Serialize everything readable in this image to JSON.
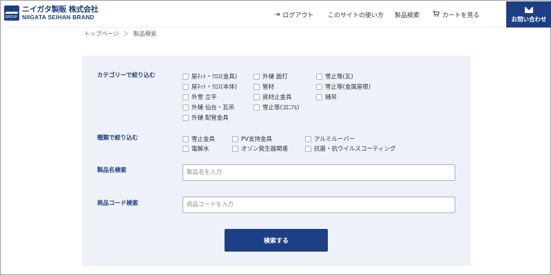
{
  "brand": {
    "mark_text": "GROUP",
    "name_jp": "ニイガタ製販 株式会社",
    "name_en": "NIIGATA SEIHAN BRAND"
  },
  "nav": {
    "logout": "ログアウト",
    "howto": "このサイトの使い方",
    "product_search": "製品検索",
    "cart": "カートを見る",
    "contact": "お問い合わせ"
  },
  "breadcrumb": {
    "home": "トップページ",
    "separator": "＞",
    "current": "製品検索"
  },
  "filters": {
    "category_label": "カテゴリーで絞り込む",
    "categories": [
      "屋ﾈｯﾄ・ｸﾛｽ(金具)",
      "外樋 面打",
      "雪止等(瓦)",
      "屋ﾈｯﾄ・ｸﾛｽ(本体)",
      "管材",
      "雪止等(金属屋根)",
      "外雪 立平",
      "資材止金具",
      "樋吊",
      "外樋 仙台・瓦吊",
      "雪止等(ｺﾛﾆｱﾙ)",
      "外樋 配管金具"
    ],
    "kind_label": "種類で絞り込む",
    "kinds": [
      "雪止金具",
      "PV支持金具",
      "アルミルーバー",
      "電解水",
      "オゾン発生器関連",
      "抗菌・抗ウイルスコーティング"
    ],
    "name_label": "製品名検索",
    "name_placeholder": "製品名を入力",
    "code_label": "商品コード検索",
    "code_placeholder": "商品コードを入力",
    "submit": "検索する"
  },
  "colors": {
    "brand_navy": "#1d3f86",
    "panel_bg": "#eef2f8"
  },
  "icons": {
    "logout": "logout-icon",
    "cart": "cart-icon",
    "contact": "envelope-icon"
  }
}
